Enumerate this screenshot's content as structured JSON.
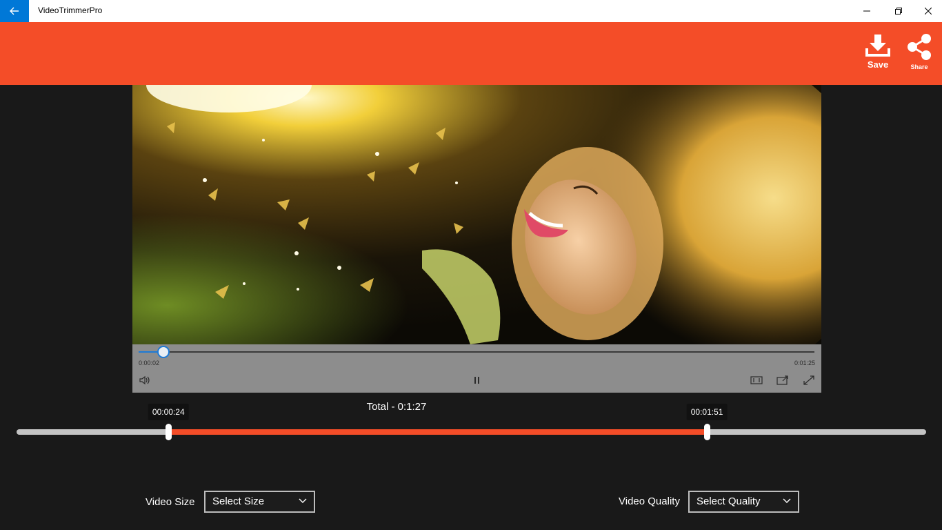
{
  "titlebar": {
    "title": "VideoTrimmerPro",
    "icons": {
      "back": "arrow-left-icon",
      "minimize": "minimize-icon",
      "maximize": "restore-icon",
      "close": "close-icon"
    }
  },
  "header": {
    "color": "#f44d28",
    "save_label": "Save",
    "share_label": "Share"
  },
  "player": {
    "current_time": "0:00:02",
    "end_time": "0:01:25",
    "position_fraction": 0.037,
    "state": "playing",
    "accent": "#1e7ad6"
  },
  "trim": {
    "total_label": "Total - 0:1:27",
    "start_label": "00:00:24",
    "end_label": "00:01:51",
    "start_fraction": 0.167,
    "end_fraction": 0.759,
    "range_color": "#f44d28"
  },
  "options": {
    "size_label": "Video Size",
    "size_value": "Select Size",
    "quality_label": "Video Quality",
    "quality_value": "Select Quality"
  }
}
